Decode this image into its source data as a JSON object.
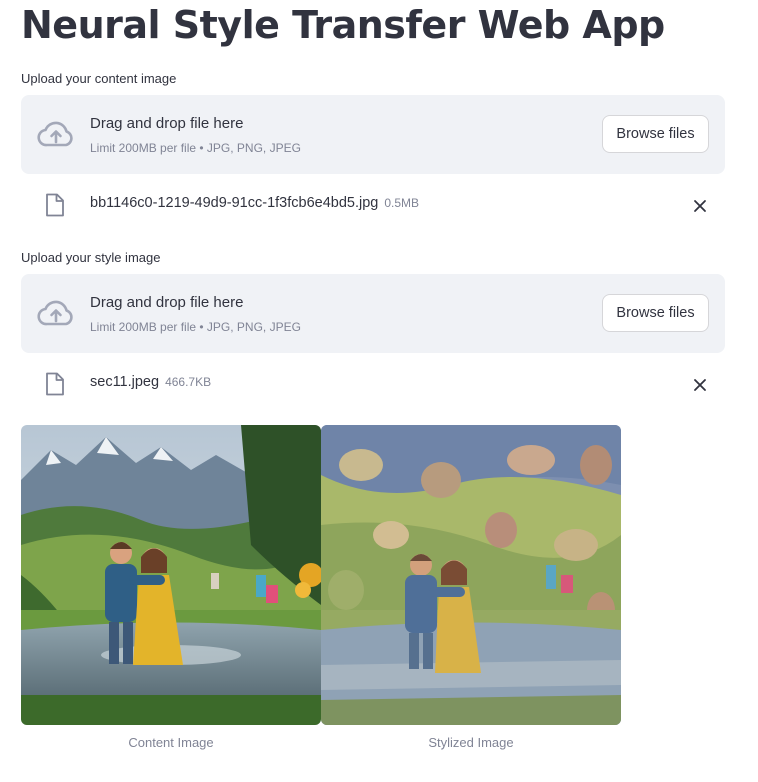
{
  "app": {
    "title": "Neural Style Transfer Web App"
  },
  "content_uploader": {
    "label": "Upload your content image",
    "drop_text": "Drag and drop file here",
    "limit_text": "Limit 200MB per file • JPG, PNG, JPEG",
    "browse_label": "Browse files",
    "file": {
      "name": "bb1146c0-1219-49d9-91cc-1f3fcb6e4bd5.jpg",
      "size": "0.5MB"
    }
  },
  "style_uploader": {
    "label": "Upload your style image",
    "drop_text": "Drag and drop file here",
    "limit_text": "Limit 200MB per file • JPG, PNG, JPEG",
    "browse_label": "Browse files",
    "file": {
      "name": "sec11.jpeg",
      "size": "466.7KB"
    }
  },
  "results": {
    "content_caption": "Content Image",
    "stylized_caption": "Stylized Image"
  },
  "icons": {
    "upload": "cloud-upload-icon",
    "file": "file-icon",
    "close": "close-icon"
  },
  "colors": {
    "dropzone_bg": "#f0f2f6",
    "text": "#31333f",
    "muted": "#808495"
  }
}
